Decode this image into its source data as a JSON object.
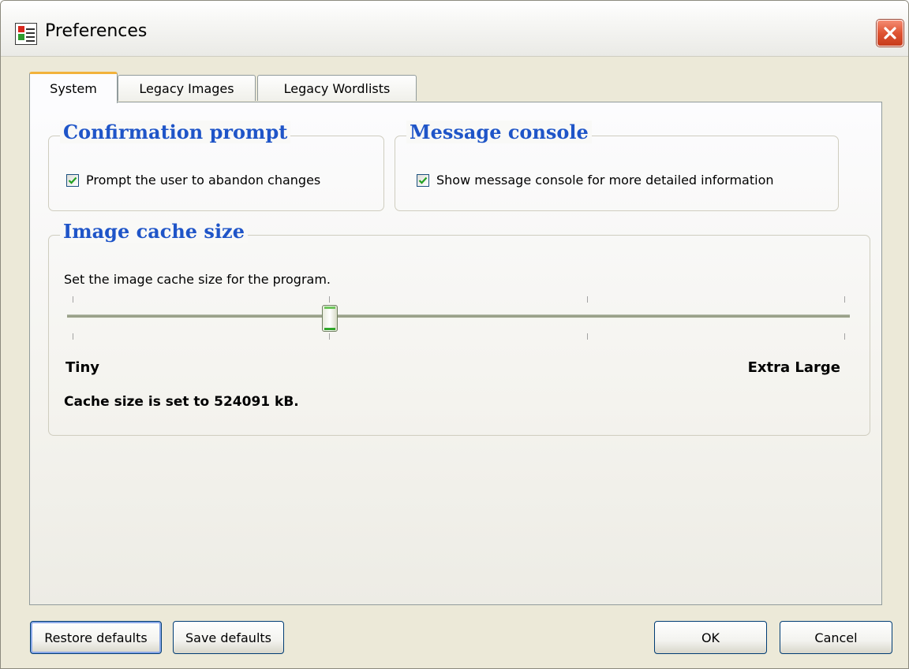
{
  "window": {
    "title": "Preferences",
    "icon": "preferences-app-icon",
    "close_icon": "close-icon"
  },
  "tabs": [
    {
      "label": "System",
      "active": true
    },
    {
      "label": "Legacy Images",
      "active": false
    },
    {
      "label": "Legacy Wordlists",
      "active": false
    }
  ],
  "confirmation": {
    "title": "Confirmation prompt",
    "checkbox_label": "Prompt the user to abandon changes",
    "checked": true
  },
  "console": {
    "title": "Message console",
    "checkbox_label": "Show message console for more detailed information",
    "checked": true
  },
  "cache": {
    "title": "Image cache size",
    "description": "Set the image cache size for the program.",
    "min_label": "Tiny",
    "max_label": "Extra Large",
    "status": "Cache size is set to 524091 kB.",
    "slider_position_fraction": 0.33,
    "tick_count": 4
  },
  "buttons": {
    "restore": "Restore defaults",
    "save": "Save defaults",
    "ok": "OK",
    "cancel": "Cancel"
  },
  "colors": {
    "group_title": "#1f55c8",
    "close_button": "#df5433",
    "active_tab_accent": "#f2b23b",
    "checkmark": "#21a121"
  }
}
